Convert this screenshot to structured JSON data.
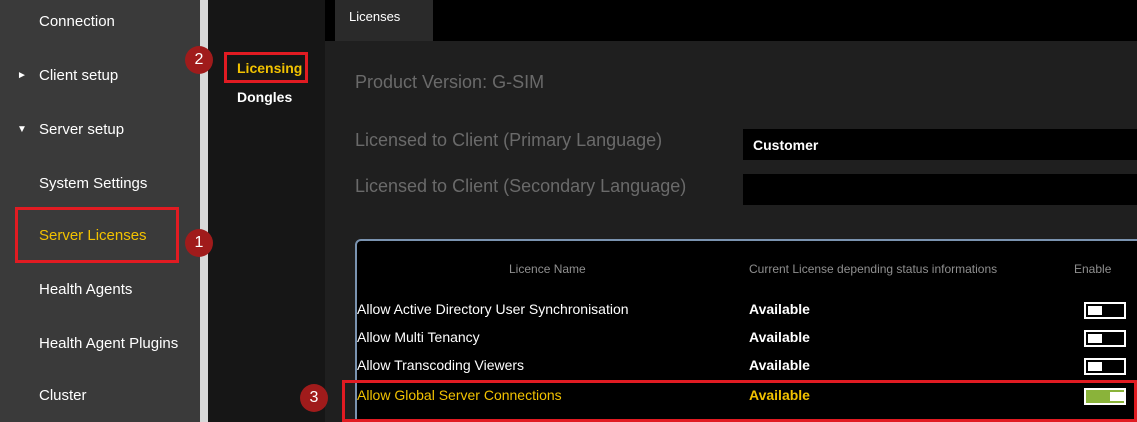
{
  "sidebar": {
    "items": [
      {
        "label": "Connection"
      },
      {
        "label": "Client setup"
      },
      {
        "label": "Server setup"
      },
      {
        "label": "System Settings"
      },
      {
        "label": "Server Licenses"
      },
      {
        "label": "Health Agents"
      },
      {
        "label": "Health Agent Plugins"
      },
      {
        "label": "Cluster"
      }
    ]
  },
  "subnav": {
    "items": [
      {
        "label": "Licensing"
      },
      {
        "label": "Dongles"
      }
    ]
  },
  "tabs": [
    {
      "label": "Licenses"
    }
  ],
  "main": {
    "product_version": "Product Version: G-SIM",
    "primary_label": "Licensed to Client (Primary Language)",
    "primary_value": "Customer",
    "secondary_label": "Licensed to Client (Secondary Language)",
    "secondary_value": ""
  },
  "table": {
    "headers": [
      "Licence Name",
      "Current License depending status informations",
      "Enable"
    ],
    "rows": [
      {
        "name": "Allow Active Directory User Synchronisation",
        "status": "Available",
        "enabled": false
      },
      {
        "name": "Allow Multi Tenancy",
        "status": "Available",
        "enabled": false
      },
      {
        "name": "Allow Transcoding Viewers",
        "status": "Available",
        "enabled": false
      },
      {
        "name": "Allow Global Server Connections",
        "status": "Available",
        "enabled": true
      }
    ]
  },
  "annotations": [
    "1",
    "2",
    "3"
  ],
  "colors": {
    "accent": "#f2c200",
    "annotation_red": "#e11b22",
    "toggle_on": "#8ab33a"
  }
}
